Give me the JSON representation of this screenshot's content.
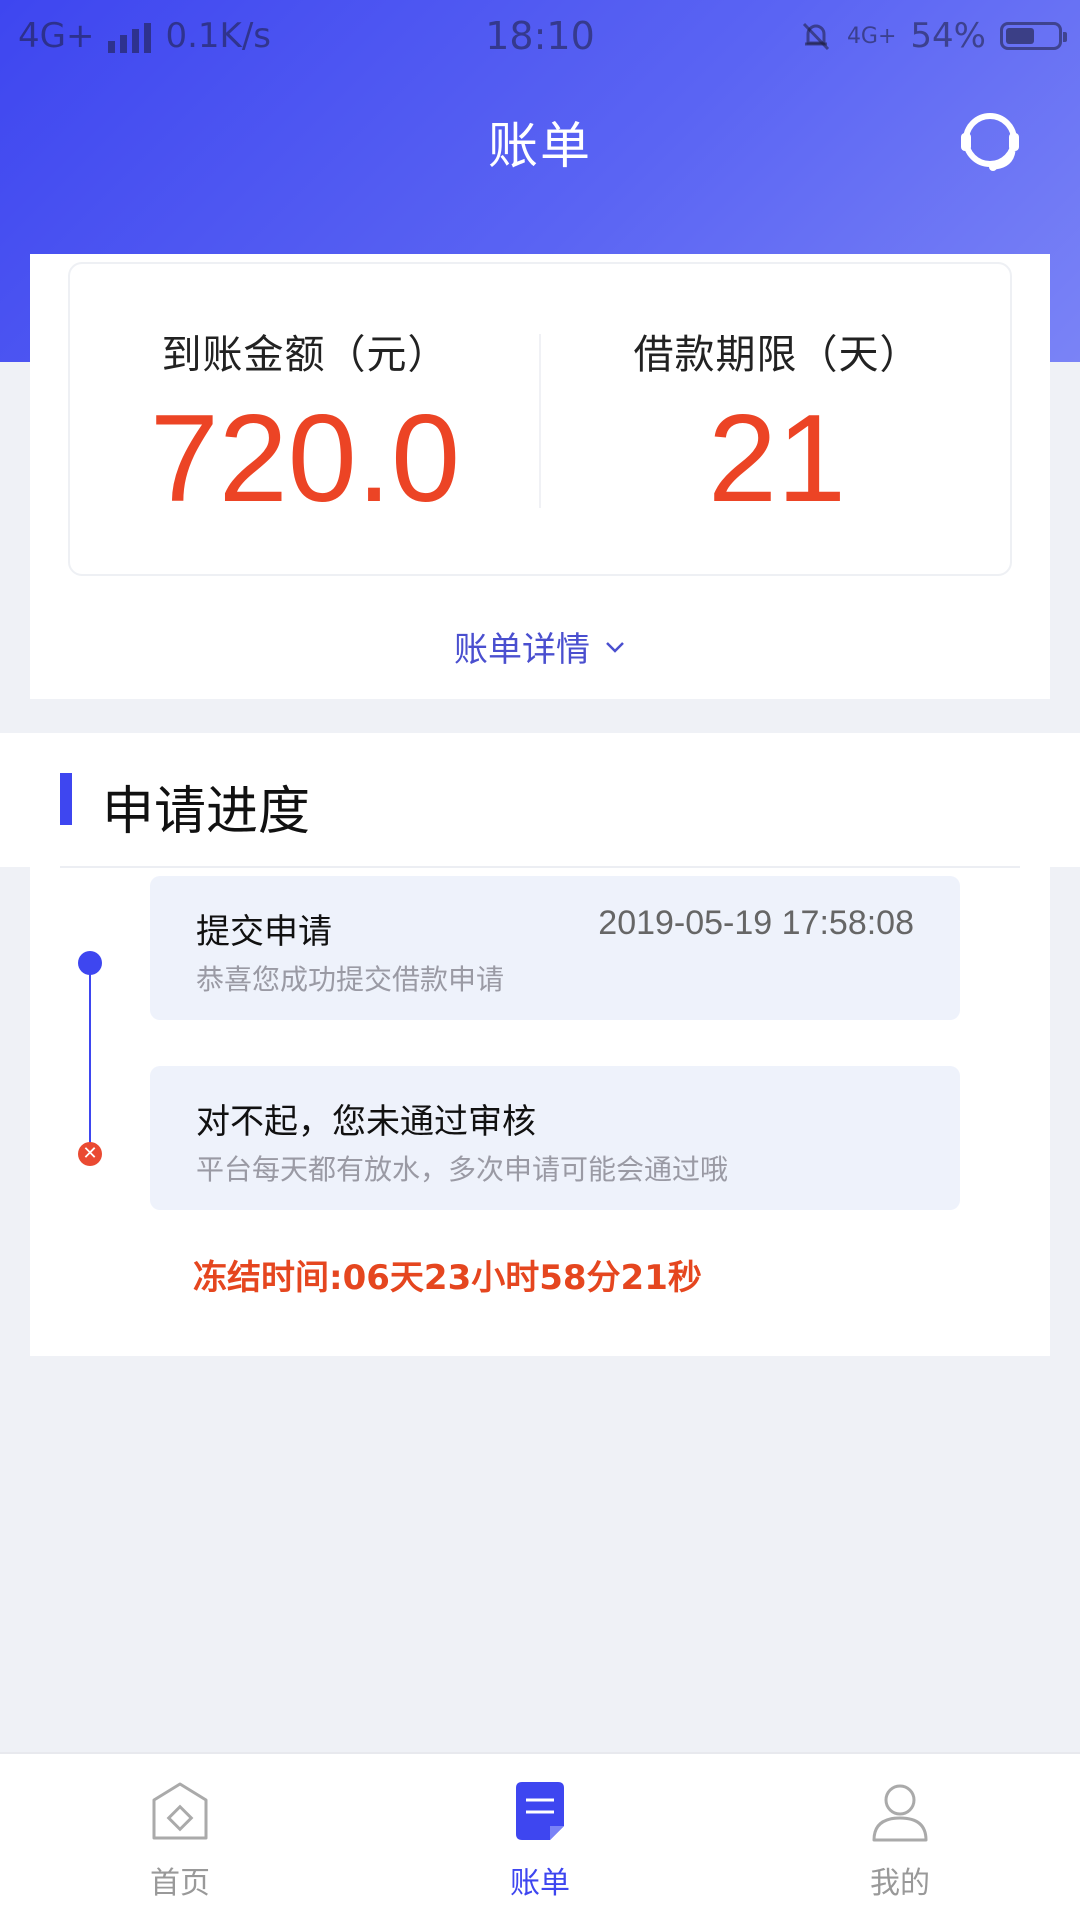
{
  "status_bar": {
    "network": "4G+",
    "speed": "0.1K/s",
    "time": "18:10",
    "network_right": "4G+",
    "battery": "54%"
  },
  "header": {
    "title": "账单",
    "support_icon": "headset-icon"
  },
  "summary": {
    "amount_label": "到账金额（元）",
    "amount_value": "720.0",
    "term_label": "借款期限（天）",
    "term_value": "21",
    "details_link": "账单详情",
    "value_color": "#ec4425"
  },
  "progress": {
    "section_title": "申请进度",
    "steps": [
      {
        "title": "提交申请",
        "time": "2019-05-19 17:58:08",
        "subtitle": "恭喜您成功提交借款申请",
        "status": "done"
      },
      {
        "title": "对不起，您未通过审核",
        "subtitle": "平台每天都有放水，多次申请可能会通过哦",
        "status": "rejected"
      }
    ],
    "freeze_text": "冻结时间:06天23小时58分21秒"
  },
  "tabbar": {
    "items": [
      {
        "label": "首页",
        "icon": "home-icon",
        "active": false
      },
      {
        "label": "账单",
        "icon": "bill-icon",
        "active": true
      },
      {
        "label": "我的",
        "icon": "user-icon",
        "active": false
      }
    ]
  },
  "colors": {
    "accent": "#3e46f0",
    "danger": "#ec4425"
  }
}
